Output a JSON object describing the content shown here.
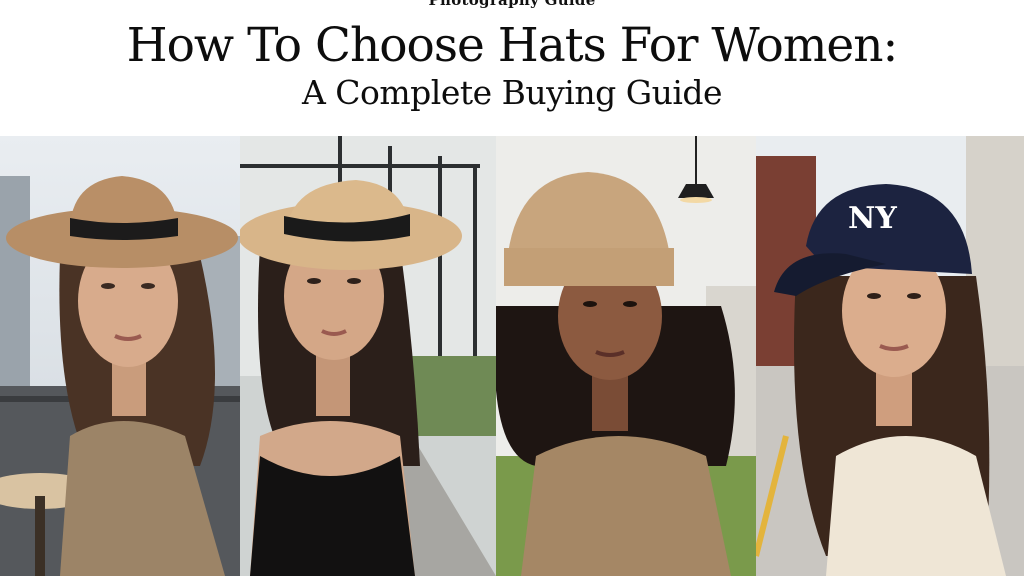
{
  "header": {
    "kicker": "Photography Guide",
    "title": "How To Choose Hats For Women:",
    "subtitle": "A Complete Buying Guide"
  },
  "photos": [
    {
      "subject": "woman wearing wide-brim fedora",
      "hat_color": "#b78e66",
      "band_color": "#1c1b1b"
    },
    {
      "subject": "woman wearing straw boater hat",
      "hat_color": "#d8b589",
      "band_color": "#1a1a1a"
    },
    {
      "subject": "woman wearing ribbed beanie",
      "hat_color": "#c8a57d"
    },
    {
      "subject": "woman wearing navy baseball cap",
      "hat_color": "#1c2340",
      "logo": "NY"
    }
  ]
}
